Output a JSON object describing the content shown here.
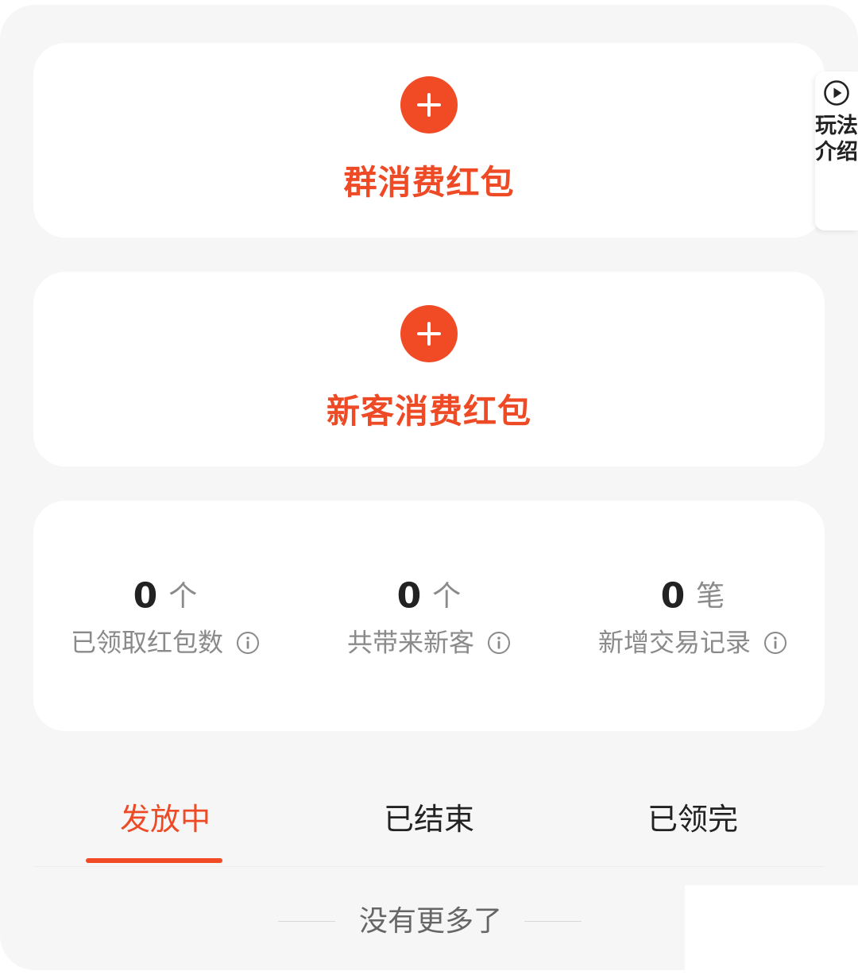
{
  "colors": {
    "accent": "#f04b24",
    "accent_text": "#ee4a26",
    "text_primary": "#222222",
    "text_secondary": "#8a8a8a",
    "background": "#f6f6f6",
    "card": "#ffffff"
  },
  "create_cards": [
    {
      "label": "群消费红包",
      "icon": "plus-icon"
    },
    {
      "label": "新客消费红包",
      "icon": "plus-icon"
    }
  ],
  "side_tab": {
    "icon": "play-circle-icon",
    "label": "玩法介绍"
  },
  "stats": [
    {
      "value": "0",
      "unit": "个",
      "label": "已领取红包数",
      "icon": "info-icon"
    },
    {
      "value": "0",
      "unit": "个",
      "label": "共带来新客",
      "icon": "info-icon"
    },
    {
      "value": "0",
      "unit": "笔",
      "label": "新增交易记录",
      "icon": "info-icon"
    }
  ],
  "tabs": {
    "items": [
      {
        "label": "发放中",
        "active": true
      },
      {
        "label": "已结束",
        "active": false
      },
      {
        "label": "已领完",
        "active": false
      }
    ]
  },
  "empty_state": {
    "text": "没有更多了"
  }
}
